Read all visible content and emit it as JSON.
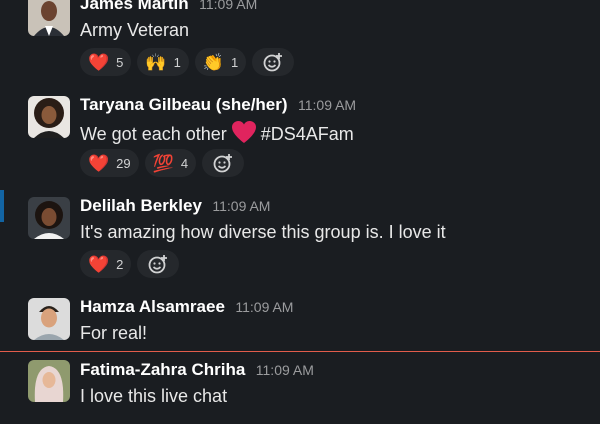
{
  "messages": [
    {
      "name": "James Martin",
      "time": "11:09 AM",
      "text": "Army Veteran",
      "reactions": [
        {
          "emoji": "❤️",
          "count": "5"
        },
        {
          "emoji": "🙌",
          "count": "1"
        },
        {
          "emoji": "👏",
          "count": "1"
        }
      ]
    },
    {
      "name": "Taryana Gilbeau (she/her)",
      "time": "11:09 AM",
      "text_before": "We got each other",
      "text_after": "#DS4AFam",
      "reactions": [
        {
          "emoji": "❤️",
          "count": "29"
        },
        {
          "emoji": "💯",
          "count": "4"
        }
      ]
    },
    {
      "name": "Delilah Berkley",
      "time": "11:09 AM",
      "text": "It's amazing how diverse this group is. I love it",
      "reactions": [
        {
          "emoji": "❤️",
          "count": "2"
        }
      ]
    },
    {
      "name": "Hamza Alsamraee",
      "time": "11:09 AM",
      "text": "For real!"
    },
    {
      "name": "Fatima-Zahra Chriha",
      "time": "11:09 AM",
      "text": "I love this live chat"
    }
  ],
  "add_reaction_icon": "add-emoji-icon",
  "colors": {
    "background": "#1a1d21",
    "accent": "#1264a3",
    "unread_divider": "#e25c4b",
    "reaction_pill": "#25282c"
  }
}
